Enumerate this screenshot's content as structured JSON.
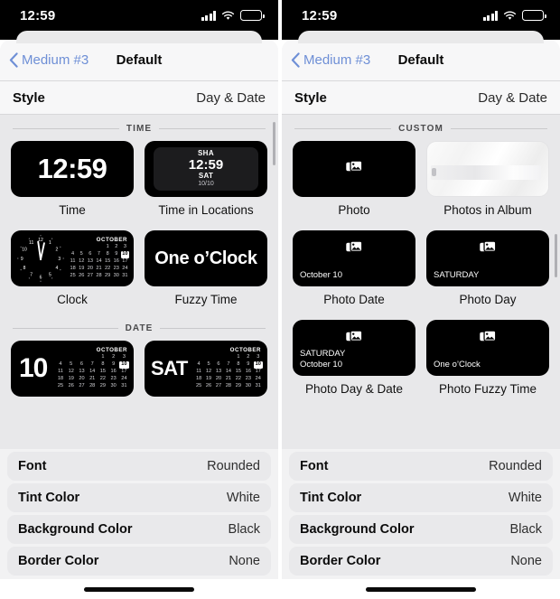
{
  "status_bar": {
    "time": "12:59",
    "signal_icon": "cellular-bars-icon",
    "wifi_icon": "wifi-icon",
    "battery_icon": "battery-icon",
    "battery_level_pct": 42
  },
  "nav": {
    "back_label": "Medium #3",
    "title": "Default",
    "back_icon": "chevron-left-icon"
  },
  "style_row": {
    "label": "Style",
    "value": "Day & Date"
  },
  "left_panel": {
    "sections": [
      {
        "title": "TIME",
        "items": [
          {
            "label": "Time",
            "preview": {
              "kind": "big-time",
              "text": "12:59"
            }
          },
          {
            "label": "Time in Locations",
            "preview": {
              "kind": "locations",
              "city": "SHA",
              "time": "12:59",
              "day": "SAT",
              "date": "10/10"
            }
          },
          {
            "label": "Clock",
            "preview": {
              "kind": "analog-calendar",
              "month": "OCTOBER",
              "today": 10
            }
          },
          {
            "label": "Fuzzy Time",
            "preview": {
              "kind": "fuzzy",
              "text": "One o’Clock"
            }
          }
        ]
      },
      {
        "title": "DATE",
        "items": [
          {
            "label": "",
            "preview": {
              "kind": "date-calendar",
              "big": "10",
              "month": "OCTOBER",
              "today": 10
            }
          },
          {
            "label": "",
            "preview": {
              "kind": "date-calendar",
              "big": "SAT",
              "month": "OCTOBER",
              "today": 10
            }
          }
        ]
      }
    ]
  },
  "right_panel": {
    "sections": [
      {
        "title": "CUSTOM",
        "items": [
          {
            "label": "Photo",
            "preview": {
              "kind": "photo",
              "icon": "photo-stack-icon"
            }
          },
          {
            "label": "Photos in Album",
            "preview": {
              "kind": "album",
              "icon": "photo-stack-icon"
            }
          },
          {
            "label": "Photo Date",
            "preview": {
              "kind": "photo-text",
              "icon": "photo-stack-icon",
              "line1": "October 10"
            }
          },
          {
            "label": "Photo Day",
            "preview": {
              "kind": "photo-text",
              "icon": "photo-stack-icon",
              "line1": "SATURDAY"
            }
          },
          {
            "label": "Photo Day & Date",
            "preview": {
              "kind": "photo-text",
              "icon": "photo-stack-icon",
              "line1": "SATURDAY",
              "line2": "October 10"
            }
          },
          {
            "label": "Photo Fuzzy Time",
            "preview": {
              "kind": "photo-text",
              "icon": "photo-stack-icon",
              "line1": "One o’Clock"
            }
          }
        ]
      }
    ]
  },
  "settings_rows": [
    {
      "label": "Font",
      "value": "Rounded"
    },
    {
      "label": "Tint Color",
      "value": "White"
    },
    {
      "label": "Background Color",
      "value": "Black"
    },
    {
      "label": "Border Color",
      "value": "None"
    }
  ],
  "calendar_days": [
    "",
    "",
    "",
    "",
    "1",
    "2",
    "3",
    "4",
    "5",
    "6",
    "7",
    "8",
    "9",
    "10",
    "11",
    "12",
    "13",
    "14",
    "15",
    "16",
    "17",
    "18",
    "19",
    "20",
    "21",
    "22",
    "23",
    "24",
    "25",
    "26",
    "27",
    "28",
    "29",
    "30",
    "31"
  ],
  "clock_numerals": [
    "12",
    "1",
    "2",
    "3",
    "4",
    "5",
    "6",
    "7",
    "8",
    "9",
    "10",
    "11"
  ],
  "colors": {
    "accent": "#6e8fd6",
    "tile_bg": "#000000",
    "sheet_bg": "#f2f2f3",
    "content_bg": "#e8e8ea",
    "row_bg": "#e9e9eb"
  },
  "home_indicator": {
    "count": 2
  }
}
